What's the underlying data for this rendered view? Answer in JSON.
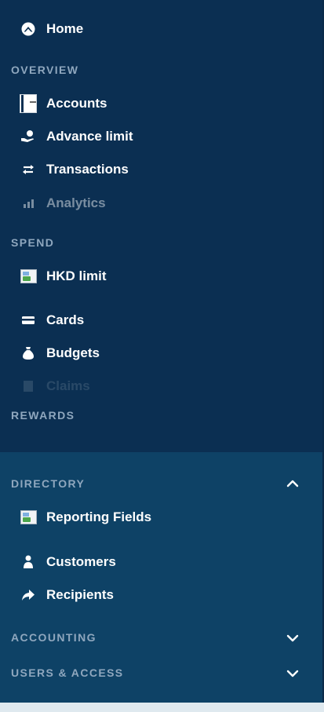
{
  "nav": {
    "home": "Home",
    "overview": {
      "header": "OVERVIEW",
      "accounts": "Accounts",
      "advance_limit": "Advance limit",
      "transactions": "Transactions",
      "analytics": "Analytics"
    },
    "spend": {
      "header": "SPEND",
      "hkd_limit": "HKD limit",
      "cards": "Cards",
      "budgets": "Budgets",
      "claims": "Claims"
    },
    "rewards": {
      "header": "REWARDS"
    },
    "directory": {
      "header": "DIRECTORY",
      "expanded": true,
      "reporting_fields": "Reporting Fields",
      "customers": "Customers",
      "recipients": "Recipients"
    },
    "accounting": {
      "header": "ACCOUNTING",
      "expanded": false
    },
    "users_access": {
      "header": "USERS & ACCESS",
      "expanded": false
    }
  },
  "colors": {
    "sidebar_bg": "#0b2f52",
    "panel_bg": "#0e4266",
    "section_text": "#8fa7be",
    "item_text": "#ffffff"
  }
}
